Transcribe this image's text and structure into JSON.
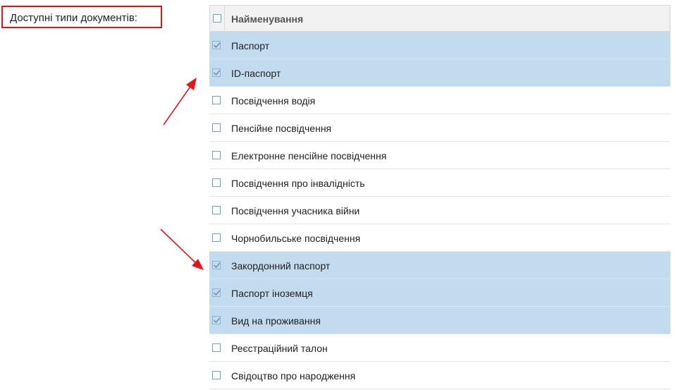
{
  "label": "Доступні типи документів:",
  "grid": {
    "header": "Найменування",
    "rows": [
      {
        "name": "Паспорт",
        "checked": true
      },
      {
        "name": "ID-паспорт",
        "checked": true
      },
      {
        "name": "Посвідчення водія",
        "checked": false
      },
      {
        "name": "Пенсійне посвідчення",
        "checked": false
      },
      {
        "name": "Електронне пенсійне посвідчення",
        "checked": false
      },
      {
        "name": "Посвідчення про інвалідність",
        "checked": false
      },
      {
        "name": "Посвідчення учасника війни",
        "checked": false
      },
      {
        "name": "Чорнобильське посвідчення",
        "checked": false
      },
      {
        "name": "Закордонний паспорт",
        "checked": true
      },
      {
        "name": "Паспорт іноземця",
        "checked": true
      },
      {
        "name": "Вид на проживання",
        "checked": true
      },
      {
        "name": "Реєстраційний талон",
        "checked": false
      },
      {
        "name": "Свідоцтво про народження",
        "checked": false
      }
    ]
  },
  "colors": {
    "selected_row": "#c3dbef",
    "annotation_red": "#e8141b"
  }
}
